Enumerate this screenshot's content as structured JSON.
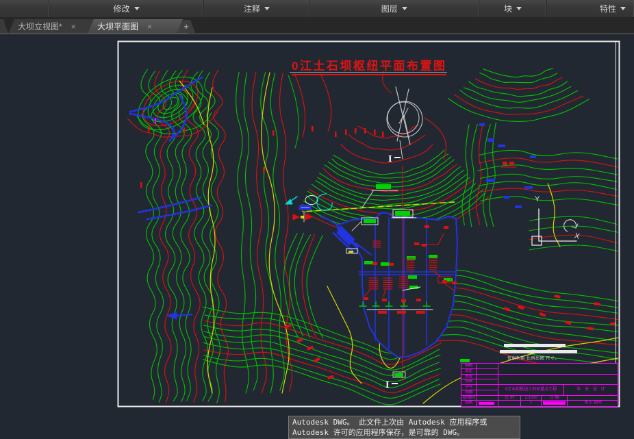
{
  "colors": {
    "canvas": "#222831",
    "frame": "#eaeaea",
    "green": "#00c400",
    "bright_green": "#00d400",
    "red": "#dd1111",
    "yellow": "#d9d900",
    "blue": "#2233e0",
    "cyan": "#00dcdc",
    "magenta": "#ff00ff",
    "white": "#efefef",
    "gray": "#c8c8c8"
  },
  "ribbon": {
    "panels": [
      {
        "label": "修改"
      },
      {
        "label": "注释"
      },
      {
        "label": "图层"
      },
      {
        "label": "块"
      },
      {
        "label": "特性"
      }
    ]
  },
  "tabs": {
    "items": [
      {
        "label": "大坝立视图*"
      },
      {
        "label": "大坝平面图"
      }
    ],
    "close_glyph": "×",
    "new_tab_glyph": "+"
  },
  "drawing": {
    "title": "0江土石坝枢纽平面布置图",
    "section_marker": "I",
    "scale_note": "仅供利用 比例出图 尺寸。",
    "ucs": {
      "x": "X",
      "y": "Y"
    }
  },
  "title_block": {
    "rows": [
      "描图",
      "审定",
      "审查",
      "校核",
      "学号",
      "制图",
      "指导教师",
      "成绩"
    ],
    "project": "0江水利枢纽土石坝重点工程",
    "project_type": "毕 业 设 计",
    "scale_label": "比 例",
    "scale_value": "1:1000",
    "date_label": "日 期",
    "dept": "水工 部分",
    "misc": "1"
  },
  "tooltip": {
    "line1": "Autodesk DWG。  此文件上次由 Autodesk 应用程序或",
    "line2": "Autodesk 许可的应用程序保存，是可靠的 DWG。"
  }
}
